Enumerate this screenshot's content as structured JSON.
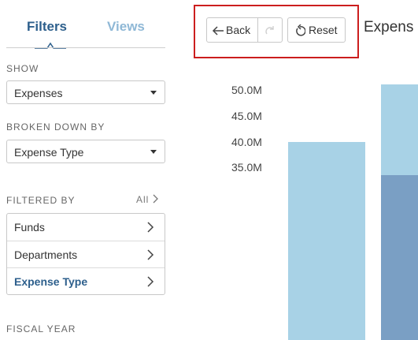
{
  "sidebar": {
    "tabs": [
      {
        "label": "Filters",
        "active": true
      },
      {
        "label": "Views",
        "active": false
      }
    ],
    "show": {
      "label": "SHOW",
      "value": "Expenses"
    },
    "broken_down_by": {
      "label": "BROKEN DOWN BY",
      "value": "Expense Type"
    },
    "filtered_by": {
      "label": "FILTERED BY",
      "all_label": "All",
      "items": [
        {
          "label": "Funds",
          "active": false
        },
        {
          "label": "Departments",
          "active": false
        },
        {
          "label": "Expense Type",
          "active": true
        }
      ]
    },
    "fiscal_year": {
      "label": "FISCAL YEAR"
    }
  },
  "toolbar": {
    "back_label": "Back",
    "reset_label": "Reset",
    "forward_icon": "redo-icon",
    "highlight_color": "#cc1e1e"
  },
  "chart_title": "Expens",
  "chart_data": {
    "type": "bar",
    "ylim": [
      31.0,
      52.0
    ],
    "yticks": [
      "50.0M",
      "45.0M",
      "40.0M",
      "35.0M"
    ],
    "ytick_values": [
      50,
      45,
      40,
      35
    ],
    "series": [
      {
        "color": "#a8d2e6",
        "values": [
          40.0,
          51.0
        ]
      },
      {
        "color": "#7a9fc4",
        "values": [
          0,
          33.6
        ]
      }
    ]
  }
}
